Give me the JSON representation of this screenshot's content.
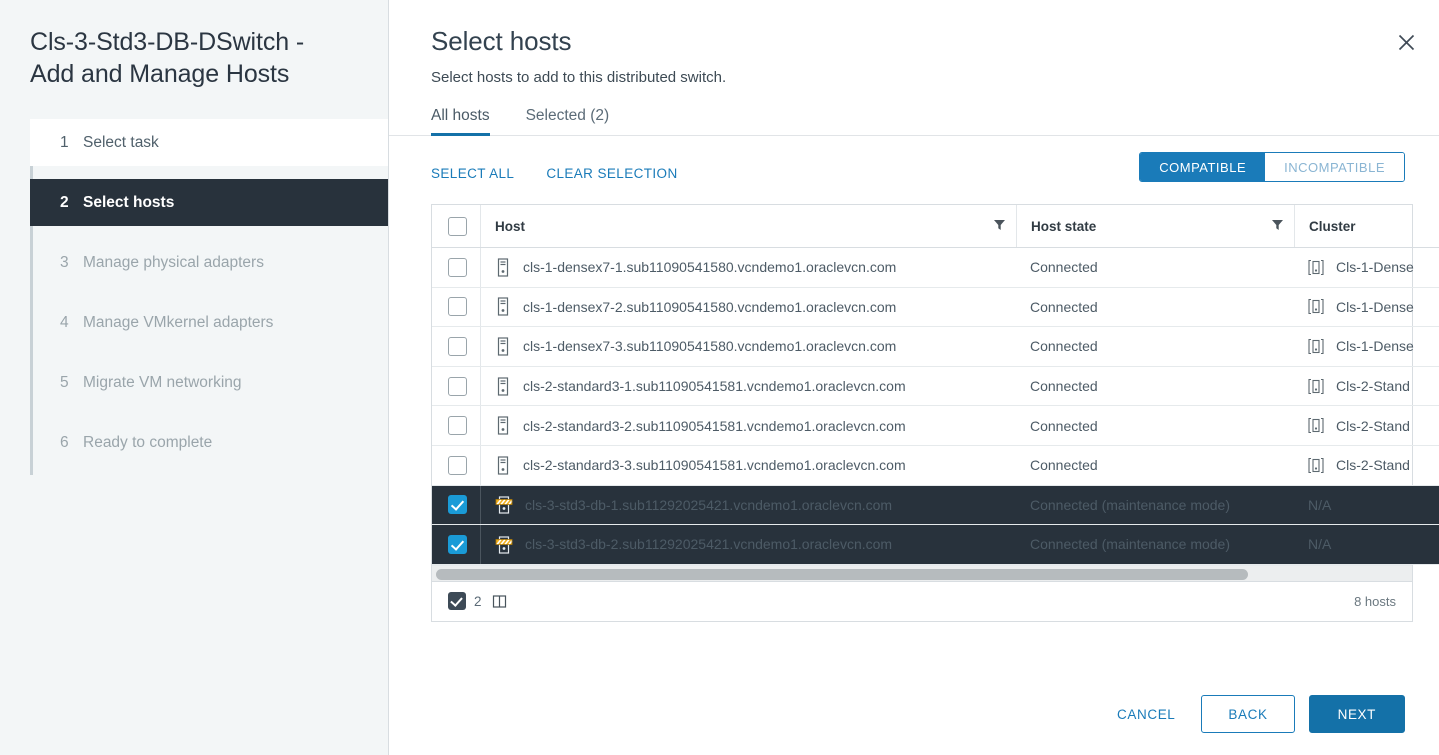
{
  "wizard": {
    "title": "Cls-3-Std3-DB-DSwitch -\nAdd and Manage Hosts",
    "steps": [
      {
        "num": "1",
        "label": "Select task",
        "state": "complete"
      },
      {
        "num": "2",
        "label": "Select hosts",
        "state": "current"
      },
      {
        "num": "3",
        "label": "Manage physical adapters",
        "state": "pending"
      },
      {
        "num": "4",
        "label": "Manage VMkernel adapters",
        "state": "pending"
      },
      {
        "num": "5",
        "label": "Migrate VM networking",
        "state": "pending"
      },
      {
        "num": "6",
        "label": "Ready to complete",
        "state": "pending"
      }
    ]
  },
  "header": {
    "title": "Select hosts",
    "subtitle": "Select hosts to add to this distributed switch.",
    "close_icon": "close-icon"
  },
  "tabs": [
    {
      "label": "All hosts",
      "active": true
    },
    {
      "label": "Selected (2)",
      "active": false
    }
  ],
  "toolbar": {
    "select_all": "SELECT ALL",
    "clear_selection": "CLEAR SELECTION",
    "segments": [
      {
        "label": "COMPATIBLE",
        "active": true
      },
      {
        "label": "INCOMPATIBLE",
        "active": false
      }
    ]
  },
  "table": {
    "columns": [
      {
        "key": "host",
        "label": "Host",
        "filterable": true
      },
      {
        "key": "state",
        "label": "Host state",
        "filterable": true
      },
      {
        "key": "cluster",
        "label": "Cluster",
        "filterable": false
      }
    ],
    "header_checkbox_checked": false,
    "rows": [
      {
        "checked": false,
        "icon": "host-icon",
        "host": "cls-1-densex7-1.sub11090541580.vcndemo1.oraclevcn.com",
        "state": "Connected",
        "cluster_icon": "cluster-icon",
        "cluster": "Cls-1-Dense"
      },
      {
        "checked": false,
        "icon": "host-icon",
        "host": "cls-1-densex7-2.sub11090541580.vcndemo1.oraclevcn.com",
        "state": "Connected",
        "cluster_icon": "cluster-icon",
        "cluster": "Cls-1-Dense"
      },
      {
        "checked": false,
        "icon": "host-icon",
        "host": "cls-1-densex7-3.sub11090541580.vcndemo1.oraclevcn.com",
        "state": "Connected",
        "cluster_icon": "cluster-icon",
        "cluster": "Cls-1-Dense"
      },
      {
        "checked": false,
        "icon": "host-icon",
        "host": "cls-2-standard3-1.sub11090541581.vcndemo1.oraclevcn.com",
        "state": "Connected",
        "cluster_icon": "cluster-icon",
        "cluster": "Cls-2-Stand"
      },
      {
        "checked": false,
        "icon": "host-icon",
        "host": "cls-2-standard3-2.sub11090541581.vcndemo1.oraclevcn.com",
        "state": "Connected",
        "cluster_icon": "cluster-icon",
        "cluster": "Cls-2-Stand"
      },
      {
        "checked": false,
        "icon": "host-icon",
        "host": "cls-2-standard3-3.sub11090541581.vcndemo1.oraclevcn.com",
        "state": "Connected",
        "cluster_icon": "cluster-icon",
        "cluster": "Cls-2-Stand"
      },
      {
        "checked": true,
        "icon": "host-maintenance-icon",
        "host": "cls-3-std3-db-1.sub11292025421.vcndemo1.oraclevcn.com",
        "state": "Connected (maintenance mode)",
        "cluster_icon": "",
        "cluster": "N/A"
      },
      {
        "checked": true,
        "icon": "host-maintenance-icon",
        "host": "cls-3-std3-db-2.sub11292025421.vcndemo1.oraclevcn.com",
        "state": "Connected (maintenance mode)",
        "cluster_icon": "",
        "cluster": "N/A"
      }
    ],
    "footer": {
      "selected_count": "2",
      "columns_icon": "columns-icon",
      "total": "8 hosts"
    }
  },
  "buttons": {
    "cancel": "CANCEL",
    "back": "BACK",
    "next": "NEXT"
  },
  "colors": {
    "accent_blue": "#1a7bb9",
    "primary_blue": "#1471a8",
    "selected_row": "#28323c",
    "step_done_green": "#3b8c2e",
    "checkbox_blue": "#1a9bd7",
    "maintenance_yellow": "#f2b01e"
  }
}
